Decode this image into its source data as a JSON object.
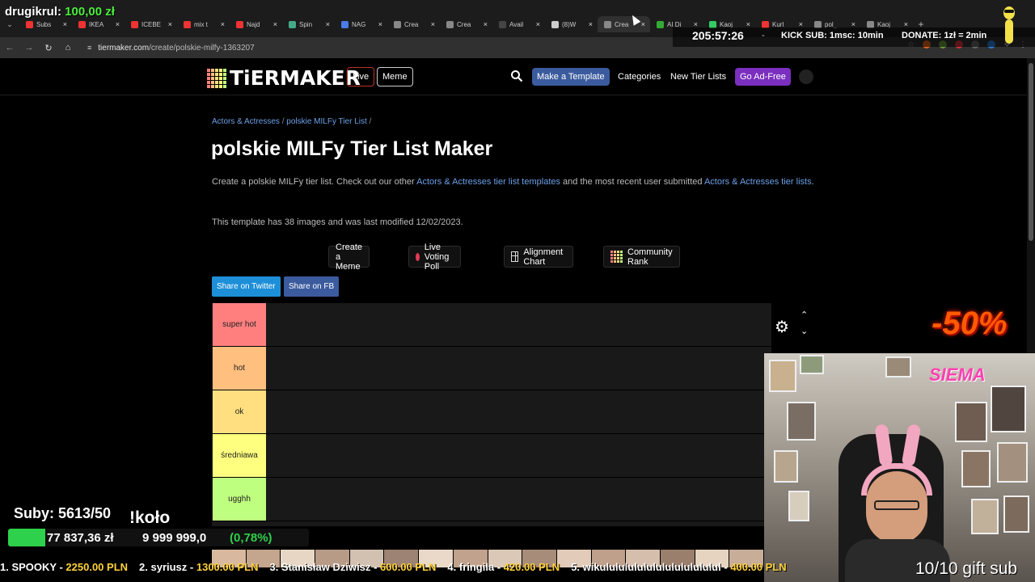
{
  "browser": {
    "tabs": [
      {
        "title": "Subs",
        "fav": "#e33"
      },
      {
        "title": "IKEA",
        "fav": "#e33"
      },
      {
        "title": "ICEBE",
        "fav": "#e33"
      },
      {
        "title": "mix t",
        "fav": "#e33"
      },
      {
        "title": "Najd",
        "fav": "#e33"
      },
      {
        "title": "Spin",
        "fav": "#4a8"
      },
      {
        "title": "NAG",
        "fav": "#4a7be8"
      },
      {
        "title": "Crea",
        "fav": "#888"
      },
      {
        "title": "Crea",
        "fav": "#888"
      },
      {
        "title": "Avail",
        "fav": "#444"
      },
      {
        "title": "(8)W",
        "fav": "#ccc"
      },
      {
        "title": "Crea",
        "fav": "#888",
        "active": true
      },
      {
        "title": "AI Di",
        "fav": "#3a3"
      },
      {
        "title": "Kaoj",
        "fav": "#3c6"
      },
      {
        "title": "Kurl",
        "fav": "#e33"
      },
      {
        "title": "pol_",
        "fav": "#888"
      },
      {
        "title": "Kaoj",
        "fav": "#888"
      }
    ],
    "url_host": "tiermaker.com",
    "url_path": "/create/polskie-milfy-1363207"
  },
  "header": {
    "logo_text": "TiERMAKER",
    "live_label": "Live",
    "meme_label": "Meme",
    "make_template_label": "Make a Template",
    "categories_label": "Categories",
    "new_tier_lists_label": "New Tier Lists",
    "ad_free_label": "Go Ad-Free"
  },
  "page": {
    "breadcrumb": {
      "category": "Actors & Actresses",
      "list": "polskie MILFy Tier List",
      "sep": "/"
    },
    "title": "polskie MILFy Tier List Maker",
    "desc_pre": "Create a polskie MILFy tier list. Check out our other ",
    "desc_link1": "Actors & Actresses tier list templates",
    "desc_mid": " and the most recent user submitted ",
    "desc_link2": "Actors & Actresses tier lists",
    "desc_end": ".",
    "meta": "This template has 38 images and was last modified 12/02/2023.",
    "actions": {
      "create_meme": "Create a Meme",
      "live_poll": "Live Voting Poll",
      "alignment": "Alignment Chart",
      "community": "Community Rank"
    },
    "share_twitter": "Share on Twitter",
    "share_fb": "Share on FB"
  },
  "tiers": [
    {
      "label": "super hot",
      "color": "#ff7f7f"
    },
    {
      "label": "hot",
      "color": "#ffbf7f"
    },
    {
      "label": "ok",
      "color": "#ffdf7f"
    },
    {
      "label": "średniawa",
      "color": "#ffff7f"
    },
    {
      "label": "ugghh",
      "color": "#bfff7f"
    }
  ],
  "overlays": {
    "donor_name": "drugikrul:",
    "donor_amount": "100,00 zł",
    "timer": "205:57:26",
    "timer_dash": "-",
    "kick_sub": "KICK SUB: 1msc: 10min",
    "donate": "DONATE: 1zł = 2min",
    "promo": "-50%",
    "subs": "Suby: 5613/50",
    "kolo": "!koło",
    "goal_current": "77 837,36 zł",
    "goal_target": "9 999 999,0",
    "goal_pct_text": "(0,78%)",
    "goal_fraction": 0.0078,
    "cam_sticker": "SIEMA",
    "ticker": [
      {
        "rank": "1. SPOOKY -",
        "amount": "2250.00 PLN"
      },
      {
        "rank": "2. syriusz -",
        "amount": "1300.00 PLN"
      },
      {
        "rank": "3. Stanisław Dziwisz -",
        "amount": "600.00 PLN"
      },
      {
        "rank": "4. fringila -",
        "amount": "420.00 PLN"
      },
      {
        "rank": "5. wikululululululululululululul -",
        "amount": "400.00 PLN"
      }
    ],
    "gift": "10/10 gift sub"
  }
}
